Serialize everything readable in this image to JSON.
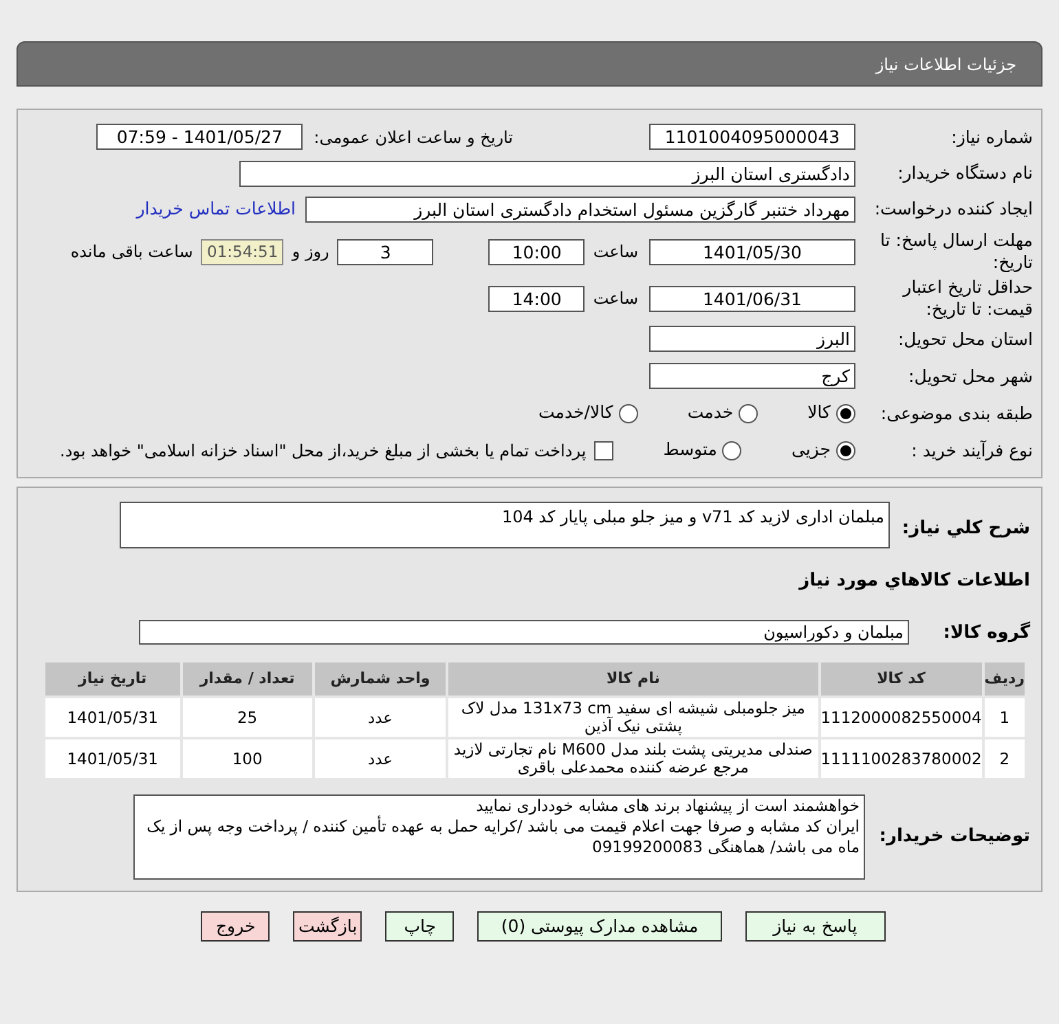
{
  "header": {
    "title": "جزئیات اطلاعات نیاز"
  },
  "form": {
    "rows": [
      {
        "label": "شماره نیاز:",
        "items": [
          {
            "kind": "field",
            "value": "1101004095000043"
          },
          {
            "kind": "text",
            "text": "تاریخ و ساعت اعلان عمومی:"
          },
          {
            "kind": "field",
            "value": "1401/05/27 - 07:59"
          }
        ]
      },
      {
        "label": "نام دستگاه خریدار:",
        "items": [
          {
            "kind": "field",
            "value": "دادگستری استان البرز"
          }
        ]
      },
      {
        "label": "ایجاد کننده درخواست:",
        "items": [
          {
            "kind": "field",
            "value": "مهرداد ختنبر گارگزین مسئول استخدام دادگستری استان البرز"
          },
          {
            "kind": "link",
            "text": "اطلاعات تماس خریدار"
          }
        ]
      },
      {
        "label": "مهلت ارسال پاسخ: تا تاریخ:",
        "items": [
          {
            "kind": "field",
            "value": "1401/05/30"
          },
          {
            "kind": "text",
            "text": "ساعت"
          },
          {
            "kind": "field",
            "value": "10:00"
          },
          {
            "kind": "field",
            "value": "3"
          },
          {
            "kind": "text",
            "text": "روز و"
          },
          {
            "kind": "timer",
            "value": "01:54:51"
          },
          {
            "kind": "text",
            "text": "ساعت باقی مانده"
          }
        ]
      },
      {
        "label": "حداقل تاریخ اعتبار قیمت: تا تاریخ:",
        "items": [
          {
            "kind": "field",
            "value": "1401/06/31"
          },
          {
            "kind": "text",
            "text": "ساعت"
          },
          {
            "kind": "field",
            "value": "14:00"
          }
        ]
      },
      {
        "label": "استان محل تحویل:",
        "items": [
          {
            "kind": "field",
            "value": "البرز"
          }
        ]
      },
      {
        "label": "شهر محل تحویل:",
        "items": [
          {
            "kind": "field",
            "value": "کرج"
          }
        ]
      },
      {
        "label": "طبقه بندی موضوعی:",
        "items": [
          {
            "kind": "radio",
            "text": "کالا",
            "selected": true
          },
          {
            "kind": "radio",
            "text": "خدمت",
            "selected": false
          },
          {
            "kind": "radio",
            "text": "کالا/خدمت",
            "selected": false
          }
        ]
      },
      {
        "label": "نوع فرآیند خرید :",
        "items": [
          {
            "kind": "radio",
            "text": "جزیی",
            "selected": true
          },
          {
            "kind": "radio",
            "text": "متوسط",
            "selected": false
          },
          {
            "kind": "checkbox",
            "text": "پرداخت تمام یا بخشی از مبلغ خرید،از محل \"اسناد خزانه اسلامی\" خواهد بود.",
            "checked": false
          }
        ]
      }
    ]
  },
  "need": {
    "label": "شرح کلي نياز:",
    "value": "مبلمان اداری لازید کد v71 و میز جلو مبلی پایار کد 104"
  },
  "goods_heading": "اطلاعات کالاهاي مورد نياز",
  "group": {
    "label": "گروه کالا:",
    "value": "مبلمان و دکوراسیون"
  },
  "table": {
    "columns": [
      "ردیف",
      "کد کالا",
      "نام کالا",
      "واحد شمارش",
      "تعداد / مقدار",
      "تاریخ نیاز"
    ],
    "rows": [
      [
        "1",
        "1112000082550004",
        "میز جلومبلی شیشه ای سفید 131x73 cm مدل لاک پشتی نیک آذین",
        "عدد",
        "25",
        "1401/05/31"
      ],
      [
        "2",
        "1111100283780002",
        "صندلی مدیریتی پشت بلند مدل M600 نام تجارتی لازید مرجع عرضه کننده محمدعلی باقری",
        "عدد",
        "100",
        "1401/05/31"
      ]
    ]
  },
  "notes": {
    "label": "توضیحات خریدار:",
    "lines": [
      "خواهشمند است از پیشنهاد برند های مشابه خودداری نمایید",
      "ایران کد مشابه و صرفا جهت اعلام قیمت می باشد /کرایه حمل به عهده تأمین کننده / پرداخت وجه پس از یک ماه می باشد/ هماهنگی 09199200083"
    ]
  },
  "buttons": [
    {
      "text": "پاسخ به نیاز",
      "kind": "primary"
    },
    {
      "text": "مشاهده مدارک پیوستی (0)",
      "kind": "primary"
    },
    {
      "text": "چاپ",
      "kind": "primary"
    },
    {
      "text": "بازگشت",
      "kind": "danger"
    },
    {
      "text": "خروج",
      "kind": "danger"
    }
  ]
}
